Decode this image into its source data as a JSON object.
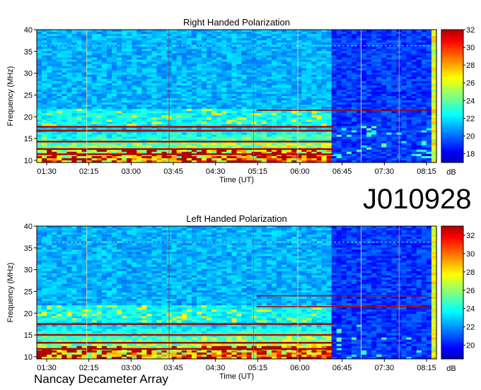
{
  "observation_id": "J010928",
  "footer": "Nancay Decameter Array",
  "chart_data": [
    {
      "type": "heatmap",
      "title": "Right Handed Polarization",
      "xlabel": "Time (UT)",
      "ylabel": "Frequency (MHz)",
      "x_ticks": [
        "01:30",
        "02:15",
        "03:00",
        "03:45",
        "04:30",
        "05:15",
        "06:00",
        "06:45",
        "07:30",
        "08:15"
      ],
      "y_ticks": [
        10,
        15,
        20,
        25,
        30,
        35,
        40
      ],
      "ylim": [
        9.5,
        40
      ],
      "colorbar": {
        "label": "dB",
        "ticks": [
          18,
          20,
          22,
          24,
          26,
          28,
          30,
          32
        ],
        "range": [
          17,
          32
        ]
      },
      "colormap": "jet",
      "notable_features": {
        "reduced_intensity_after": "06:45",
        "high_intensity_band_mhz": [
          10,
          18
        ]
      }
    },
    {
      "type": "heatmap",
      "title": "Left Handed Polarization",
      "xlabel": "Time (UT)",
      "ylabel": "Frequency (MHz)",
      "x_ticks": [
        "01:30",
        "02:15",
        "03:00",
        "03:45",
        "04:30",
        "05:15",
        "06:00",
        "06:45",
        "07:30",
        "08:15"
      ],
      "y_ticks": [
        10,
        15,
        20,
        25,
        30,
        35,
        40
      ],
      "ylim": [
        9.5,
        40
      ],
      "colorbar": {
        "label": "dB",
        "ticks": [
          20,
          22,
          24,
          26,
          28,
          30,
          32
        ],
        "range": [
          18.5,
          33
        ]
      },
      "colormap": "jet",
      "notable_features": {
        "reduced_intensity_after": "06:45",
        "high_intensity_band_mhz": [
          10,
          18
        ]
      }
    }
  ]
}
